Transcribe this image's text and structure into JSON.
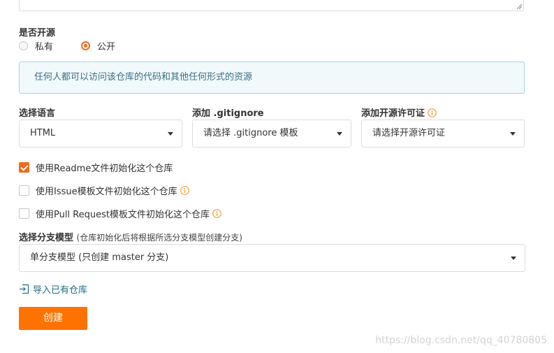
{
  "visibility": {
    "label": "是否开源",
    "options": [
      {
        "label": "私有",
        "checked": false
      },
      {
        "label": "公开",
        "checked": true
      }
    ],
    "notice": "任何人都可以访问该仓库的代码和其他任何形式的资源"
  },
  "language": {
    "label": "选择语言",
    "value": "HTML"
  },
  "gitignore": {
    "label": "添加 .gitignore",
    "value": "请选择 .gitignore 模板"
  },
  "license": {
    "label": "添加开源许可证",
    "value": "请选择开源许可证"
  },
  "init_options": [
    {
      "label": "使用Readme文件初始化这个仓库",
      "checked": true,
      "has_info": false
    },
    {
      "label": "使用Issue模板文件初始化这个仓库",
      "checked": false,
      "has_info": true
    },
    {
      "label": "使用Pull Request模板文件初始化这个仓库",
      "checked": false,
      "has_info": true
    }
  ],
  "branch_model": {
    "label": "选择分支模型",
    "hint": "(仓库初始化后将根据所选分支模型创建分支)",
    "value": "单分支模型 (只创建 master 分支)"
  },
  "import_link": "导入已有仓库",
  "create_button": "创建",
  "watermark": "https://blog.csdn.net/qq_40780805",
  "colors": {
    "accent": "#fe7300",
    "info_text": "#3b6f82",
    "info_border": "#a9d4de",
    "info_bg": "#f1f9fb",
    "link": "#1f6b8a",
    "info_icon": "#f0a340"
  }
}
